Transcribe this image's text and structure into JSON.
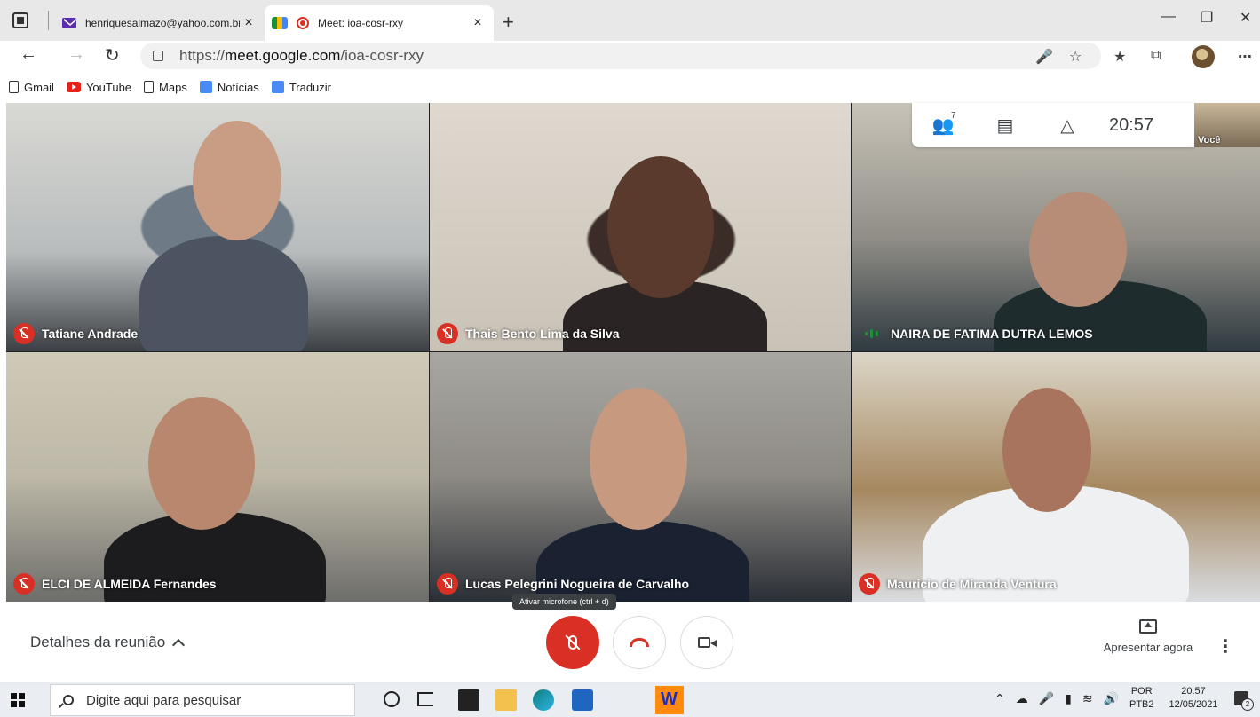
{
  "browser": {
    "tabs": [
      {
        "title": "henriquesalmazo@yahoo.com.br",
        "active": false
      },
      {
        "title": "Meet: ioa-cosr-rxy",
        "active": true
      }
    ],
    "new_tab": "+",
    "close_glyph": "×",
    "url_prefix": "https://",
    "url_domain": "meet.google.com",
    "url_path": "/ioa-cosr-rxy",
    "bookmarks": [
      "Gmail",
      "YouTube",
      "Maps",
      "Notícias",
      "Traduzir"
    ]
  },
  "meet": {
    "participants_count": "7",
    "time": "20:57",
    "self_label": "Você",
    "tiles": [
      {
        "name": "Tatiane Andrade",
        "muted": true
      },
      {
        "name": "Thais Bento Lima da Silva",
        "muted": true
      },
      {
        "name": "NAIRA DE FATIMA DUTRA LEMOS",
        "muted": false
      },
      {
        "name": "ELCI DE ALMEIDA Fernandes",
        "muted": true
      },
      {
        "name": "Lucas Pelegrini Nogueira de Carvalho",
        "muted": true
      },
      {
        "name": "Mauricio de Miranda Ventura",
        "muted": true
      }
    ],
    "details_label": "Detalhes da reunião",
    "mic_tooltip": "Ativar microfone (ctrl + d)",
    "present_label": "Apresentar agora",
    "accent_red": "#d93025"
  },
  "taskbar": {
    "search_placeholder": "Digite aqui para pesquisar",
    "lang_top": "POR",
    "lang_bottom": "PTB2",
    "clock_time": "20:57",
    "clock_date": "12/05/2021",
    "notifications": "2"
  }
}
